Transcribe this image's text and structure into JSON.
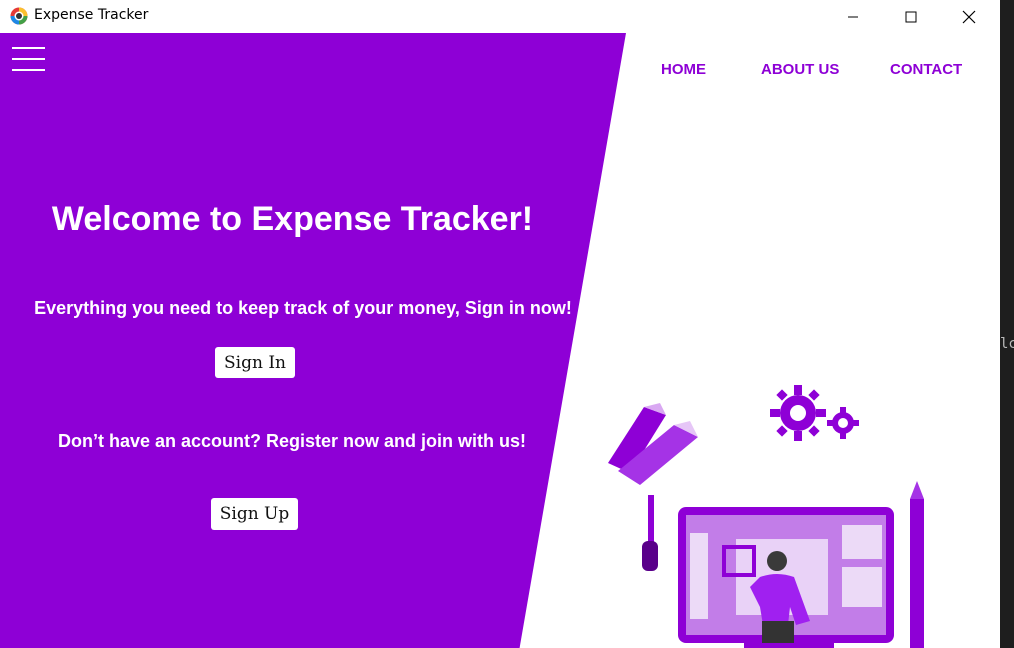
{
  "window": {
    "title": "Expense Tracker",
    "controls": [
      "minimize",
      "maximize",
      "close"
    ]
  },
  "nav": {
    "menu_icon": "hamburger-icon",
    "items": [
      {
        "label": "HOME"
      },
      {
        "label": "ABOUT US"
      },
      {
        "label": "CONTACT"
      }
    ]
  },
  "hero": {
    "heading": "Welcome to Expense Tracker!",
    "tagline": "Everything you need to keep track of your money, Sign in now!",
    "signin_label": "Sign In",
    "register_text": "Don’t have an account? Register now and join with us!",
    "signup_label": "Sign Up"
  },
  "illustration": {
    "subject": "person-at-monitor-illustration"
  },
  "background_edge_text": "lc",
  "colors": {
    "primary": "#8e00d6",
    "white": "#ffffff",
    "accent_light": "#d9a8f2"
  }
}
